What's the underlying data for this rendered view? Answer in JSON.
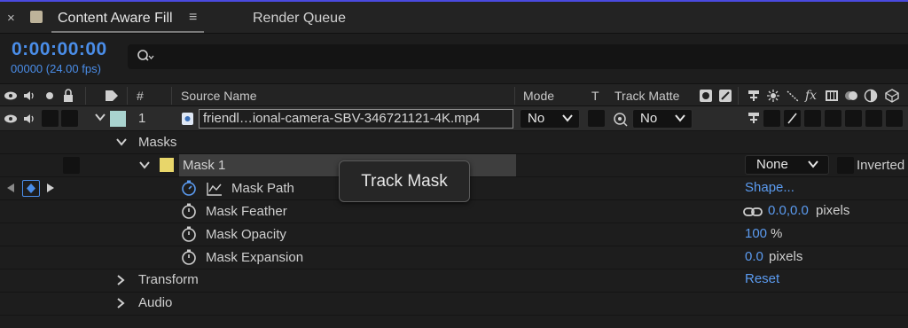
{
  "tabs": {
    "active": "Content Aware Fill",
    "render": "Render Queue"
  },
  "time": {
    "timecode": "0:00:00:00",
    "frames": "00000 (24.00 fps)"
  },
  "columns": {
    "number": "#",
    "source_name": "Source Name",
    "mode": "Mode",
    "t": "T",
    "track_matte": "Track Matte"
  },
  "layer": {
    "index": "1",
    "name": "friendl…ional-camera-SBV-346721121-4K.mp4",
    "mode_value": "No",
    "matte_value": "No"
  },
  "tree": {
    "masks": "Masks",
    "mask1": "Mask 1",
    "mask_mode": "None",
    "inverted": "Inverted",
    "mask_path": "Mask Path",
    "mask_path_value": "Shape...",
    "mask_feather": "Mask Feather",
    "mask_feather_value": "0.0,0.0",
    "mask_feather_unit": "pixels",
    "mask_opacity": "Mask Opacity",
    "mask_opacity_value": "100",
    "mask_opacity_unit": "%",
    "mask_expansion": "Mask Expansion",
    "mask_expansion_value": "0.0",
    "mask_expansion_unit": "pixels",
    "transform": "Transform",
    "transform_value": "Reset",
    "audio": "Audio"
  },
  "tooltip": "Track Mask",
  "colors": {
    "accent": "#4a8de8",
    "layer_label": "#a9d3cf",
    "mask_label": "#e8d66a"
  },
  "icons": [
    "close-icon",
    "menu-icon",
    "search-icon",
    "eye-icon",
    "speaker-icon",
    "solo-icon",
    "lock-icon",
    "label-icon",
    "chevron-down-icon",
    "chevron-right-icon",
    "stopwatch-icon",
    "graph-icon",
    "link-icon",
    "keyframe-icon"
  ]
}
